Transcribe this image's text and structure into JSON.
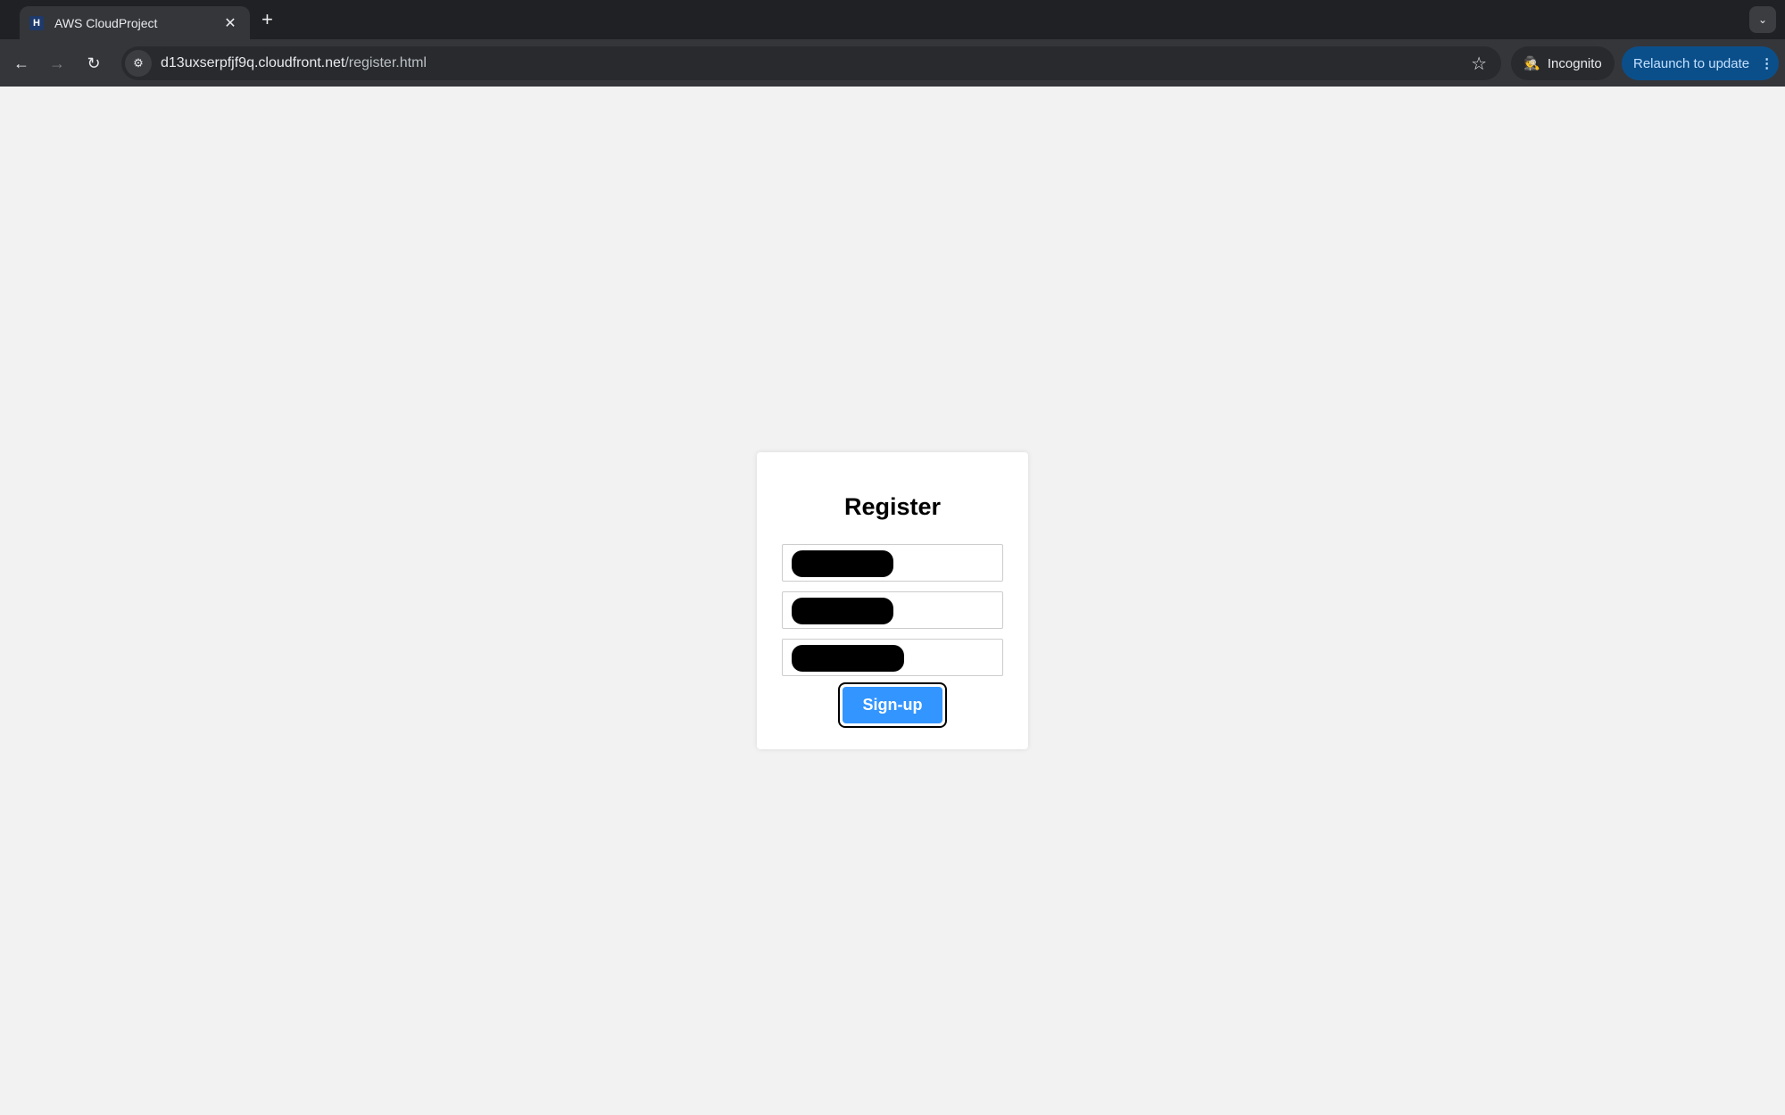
{
  "browser": {
    "tab_title": "AWS CloudProject",
    "favicon_letter": "H",
    "tab_close_glyph": "✕",
    "new_tab_glyph": "+",
    "tab_search_glyph": "⌄",
    "back_glyph": "←",
    "forward_glyph": "→",
    "reload_glyph": "↻",
    "site_info_glyph": "⚙",
    "url_host": "d13uxserpfjf9q.cloudfront.net",
    "url_path": "/register.html",
    "star_glyph": "☆",
    "incognito_label": "Incognito",
    "incognito_glyph": "🕵",
    "relaunch_label": "Relaunch to update",
    "menu_glyph": "⋮"
  },
  "form": {
    "title": "Register",
    "fields": [
      {
        "name": "username",
        "value": "[redacted]"
      },
      {
        "name": "email",
        "value": "[redacted]"
      },
      {
        "name": "password",
        "value": "[redacted]"
      }
    ],
    "submit_label": "Sign-up",
    "submit_color": "#3395ff"
  }
}
